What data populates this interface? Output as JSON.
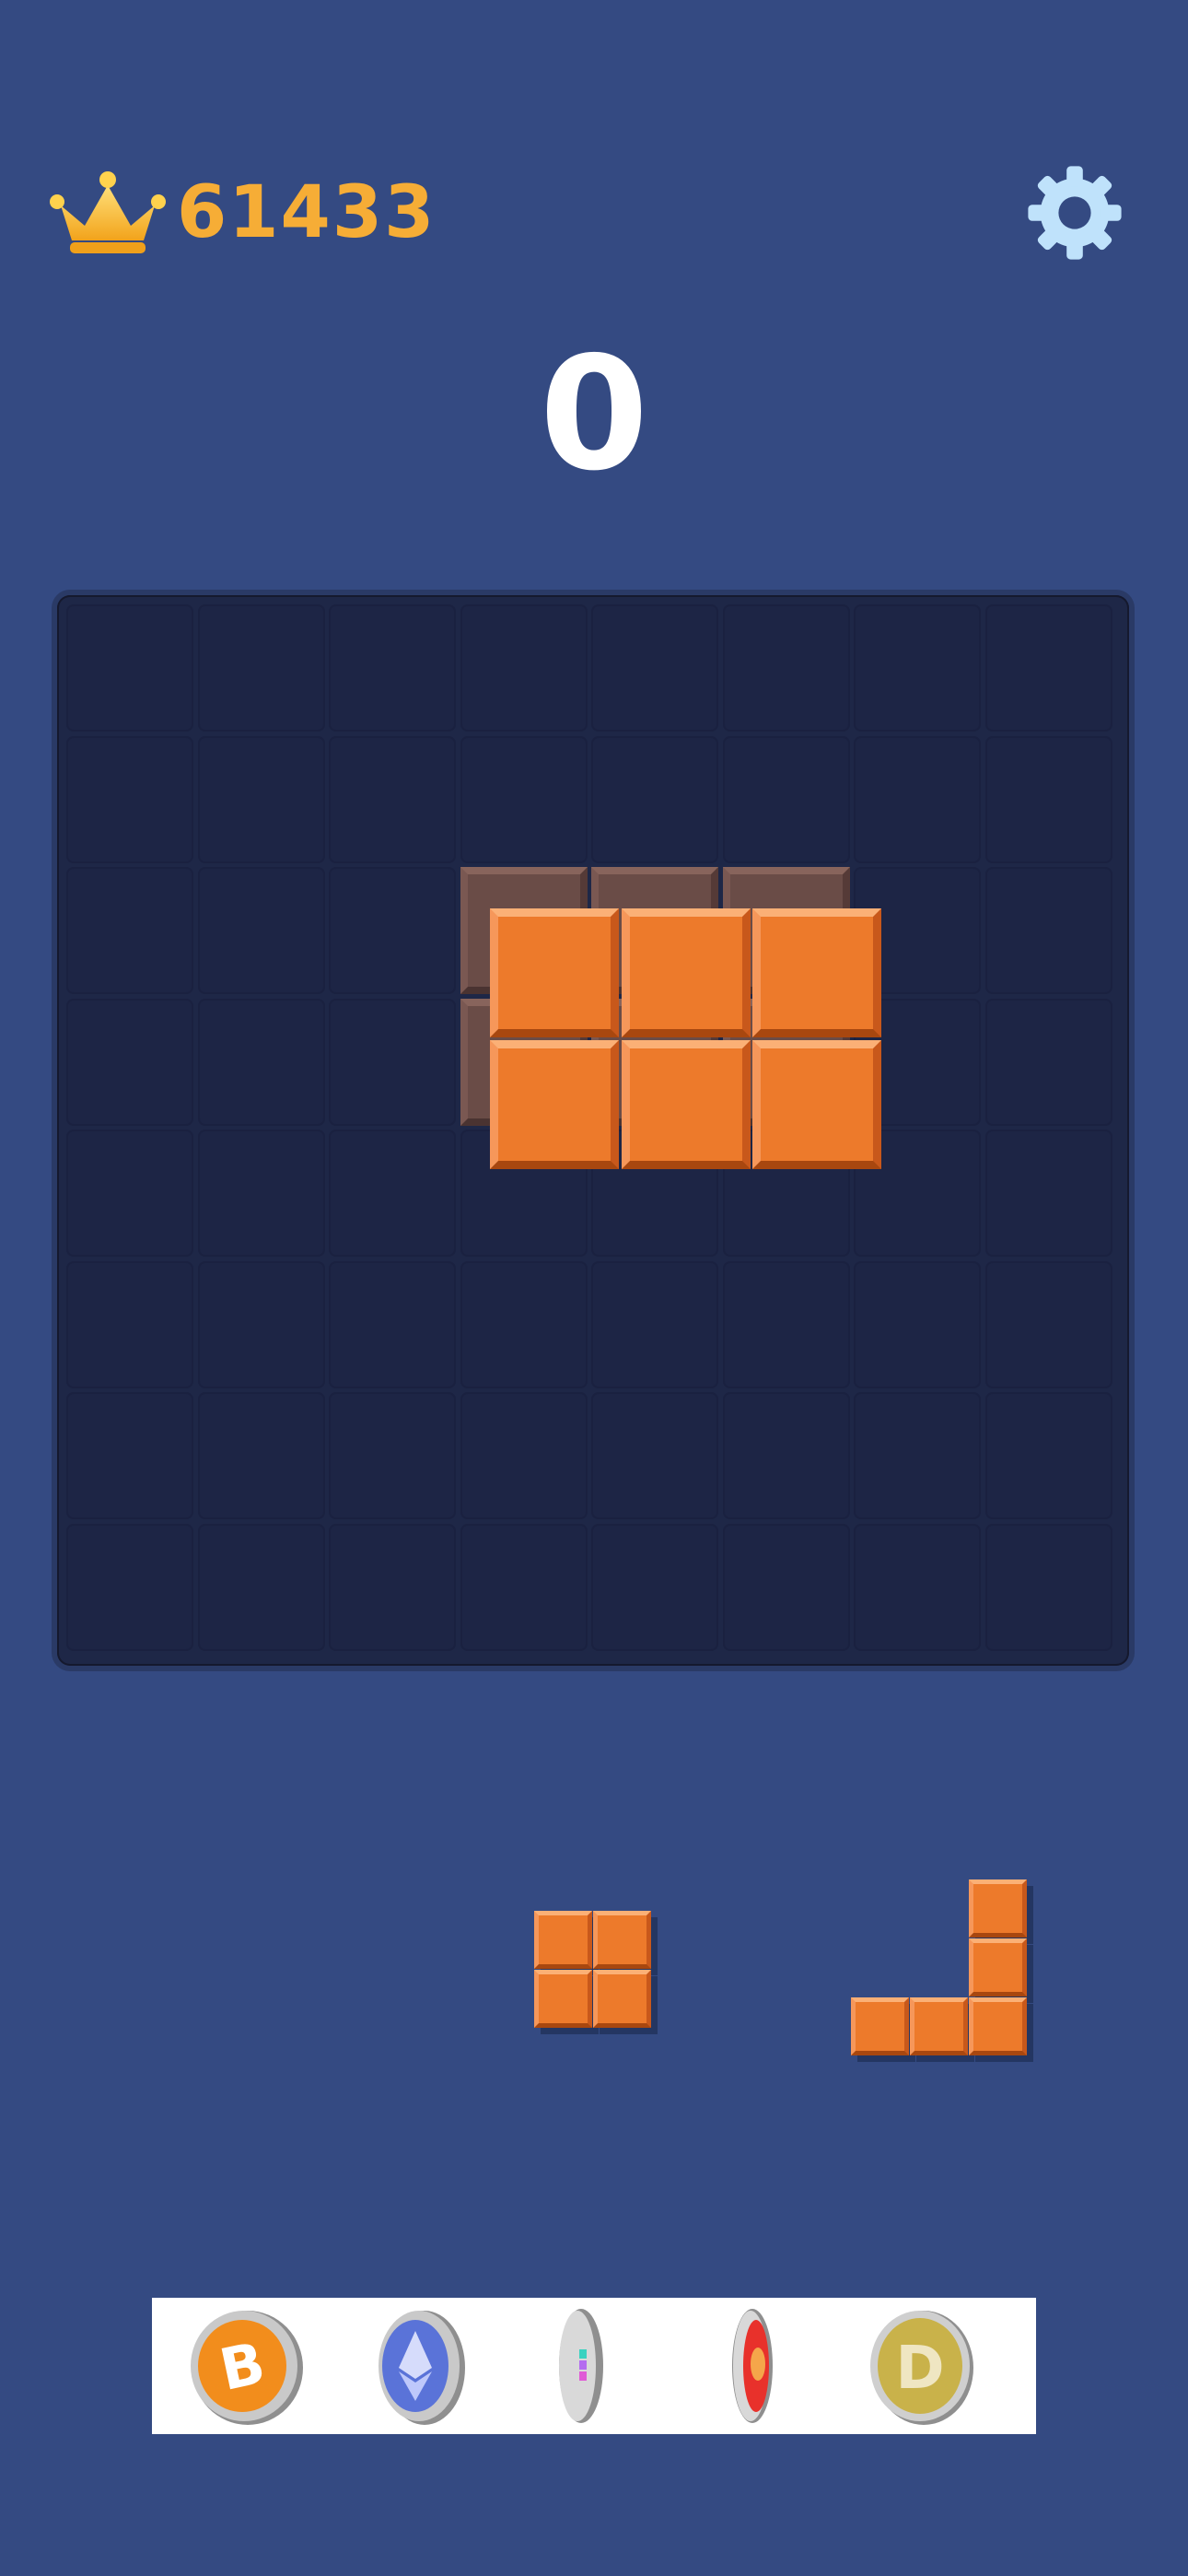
{
  "header": {
    "best_score": "61433",
    "crown_icon": "crown-icon",
    "settings_icon": "gear-icon"
  },
  "score": {
    "current": "0"
  },
  "board": {
    "rows": 8,
    "cols": 8,
    "preview_cells": [
      [
        2,
        3
      ],
      [
        2,
        4
      ],
      [
        2,
        5
      ],
      [
        3,
        3
      ],
      [
        3,
        4
      ],
      [
        3,
        5
      ]
    ],
    "dragged_piece_cells": [
      [
        0,
        0
      ],
      [
        0,
        1
      ],
      [
        0,
        2
      ],
      [
        1,
        0
      ],
      [
        1,
        1
      ],
      [
        1,
        2
      ]
    ]
  },
  "tray": {
    "pieces": [
      {
        "name": "square-2x2-piece",
        "cells": [
          [
            0,
            0
          ],
          [
            0,
            1
          ],
          [
            1,
            0
          ],
          [
            1,
            1
          ]
        ]
      },
      {
        "name": "j-shape-piece",
        "cells": [
          [
            0,
            2
          ],
          [
            1,
            2
          ],
          [
            2,
            0
          ],
          [
            2,
            1
          ],
          [
            2,
            2
          ]
        ]
      }
    ]
  },
  "ad_banner": {
    "coins": [
      "bitcoin-coin-icon",
      "ethereum-coin-icon",
      "crypto-coin-icon",
      "shiba-coin-icon",
      "dogecoin-icon"
    ]
  },
  "colors": {
    "background": "#344a82",
    "board": "#1e2747",
    "block": "#ed7a2b",
    "ghost": "#6a4c47",
    "best_score": "#f6ad36"
  }
}
